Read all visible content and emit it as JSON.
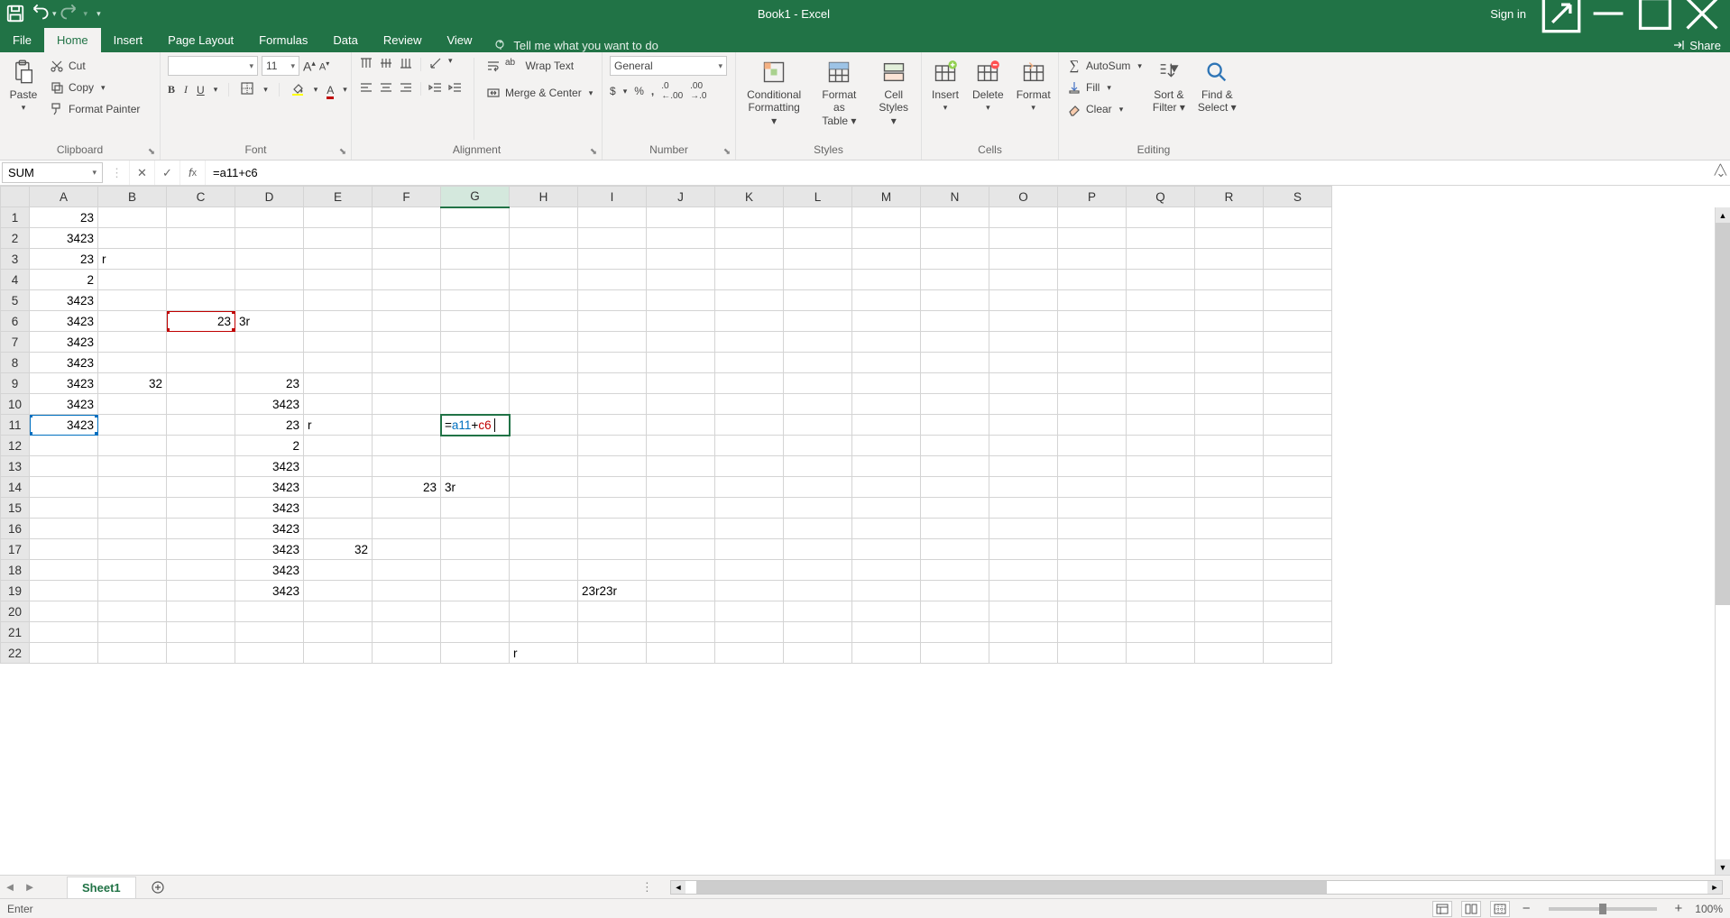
{
  "title": "Book1  -  Excel",
  "signin": "Sign in",
  "share": "Share",
  "tabs": {
    "file": "File",
    "home": "Home",
    "insert": "Insert",
    "pagelayout": "Page Layout",
    "formulas": "Formulas",
    "data": "Data",
    "review": "Review",
    "view": "View"
  },
  "tellme": "Tell me what you want to do",
  "ribbon": {
    "clipboard": {
      "label": "Clipboard",
      "paste": "Paste",
      "cut": "Cut",
      "copy": "Copy",
      "fp": "Format Painter"
    },
    "font": {
      "label": "Font",
      "name": "",
      "size": "11"
    },
    "alignment": {
      "label": "Alignment",
      "wrap": "Wrap Text",
      "merge": "Merge & Center"
    },
    "number": {
      "label": "Number",
      "format": "General"
    },
    "styles": {
      "label": "Styles",
      "cf": "Conditional Formatting",
      "fat": "Format as Table",
      "cs": "Cell Styles"
    },
    "cells": {
      "label": "Cells",
      "insert": "Insert",
      "delete": "Delete",
      "format": "Format"
    },
    "editing": {
      "label": "Editing",
      "autosum": "AutoSum",
      "fill": "Fill",
      "clear": "Clear",
      "sort": "Sort & Filter",
      "find": "Find & Select"
    }
  },
  "namebox": "SUM",
  "formula_display": "=a11+c6",
  "formula_parts": {
    "eq": "=",
    "r1": "a11",
    "plus": "+",
    "r2": "c6"
  },
  "columns": [
    "A",
    "B",
    "C",
    "D",
    "E",
    "F",
    "G",
    "H",
    "I",
    "J",
    "K",
    "L",
    "M",
    "N",
    "O",
    "P",
    "Q",
    "R",
    "S"
  ],
  "rows": 22,
  "cells": {
    "A1": "23",
    "A2": "3423",
    "A3": "23",
    "B3": "r",
    "A4": "2",
    "A5": "3423",
    "A6": "3423",
    "C6": "23",
    "D6": "3r",
    "A7": "3423",
    "A8": "3423",
    "A9": "3423",
    "B9": "32",
    "D9": "23",
    "A10": "3423",
    "D10": "3423",
    "A11": "3423",
    "D11": "23",
    "E11": "r",
    "D12": "2",
    "D13": "3423",
    "D14": "3423",
    "F14": "23",
    "G14": "3r",
    "D15": "3423",
    "D16": "3423",
    "D17": "3423",
    "E17": "32",
    "D18": "3423",
    "D19": "3423",
    "I19": "23r23r",
    "H22": "r"
  },
  "edit_cell": "G11",
  "ref_blue": "A11",
  "ref_red": "C6",
  "sheet_tab": "Sheet1",
  "status_mode": "Enter",
  "zoom": "100%"
}
